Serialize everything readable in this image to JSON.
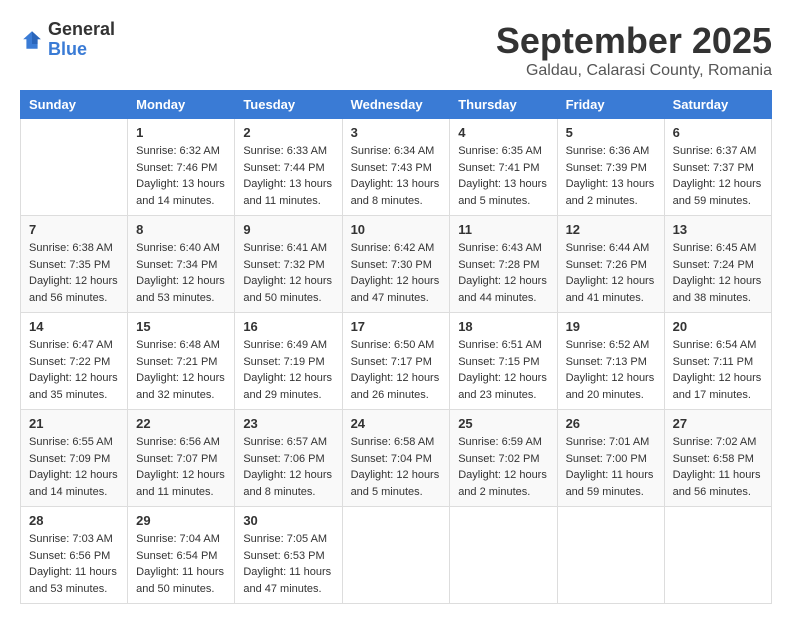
{
  "header": {
    "logo_general": "General",
    "logo_blue": "Blue",
    "month_title": "September 2025",
    "location": "Galdau, Calarasi County, Romania"
  },
  "weekdays": [
    "Sunday",
    "Monday",
    "Tuesday",
    "Wednesday",
    "Thursday",
    "Friday",
    "Saturday"
  ],
  "weeks": [
    [
      {
        "day": "",
        "info": ""
      },
      {
        "day": "1",
        "info": "Sunrise: 6:32 AM\nSunset: 7:46 PM\nDaylight: 13 hours\nand 14 minutes."
      },
      {
        "day": "2",
        "info": "Sunrise: 6:33 AM\nSunset: 7:44 PM\nDaylight: 13 hours\nand 11 minutes."
      },
      {
        "day": "3",
        "info": "Sunrise: 6:34 AM\nSunset: 7:43 PM\nDaylight: 13 hours\nand 8 minutes."
      },
      {
        "day": "4",
        "info": "Sunrise: 6:35 AM\nSunset: 7:41 PM\nDaylight: 13 hours\nand 5 minutes."
      },
      {
        "day": "5",
        "info": "Sunrise: 6:36 AM\nSunset: 7:39 PM\nDaylight: 13 hours\nand 2 minutes."
      },
      {
        "day": "6",
        "info": "Sunrise: 6:37 AM\nSunset: 7:37 PM\nDaylight: 12 hours\nand 59 minutes."
      }
    ],
    [
      {
        "day": "7",
        "info": "Sunrise: 6:38 AM\nSunset: 7:35 PM\nDaylight: 12 hours\nand 56 minutes."
      },
      {
        "day": "8",
        "info": "Sunrise: 6:40 AM\nSunset: 7:34 PM\nDaylight: 12 hours\nand 53 minutes."
      },
      {
        "day": "9",
        "info": "Sunrise: 6:41 AM\nSunset: 7:32 PM\nDaylight: 12 hours\nand 50 minutes."
      },
      {
        "day": "10",
        "info": "Sunrise: 6:42 AM\nSunset: 7:30 PM\nDaylight: 12 hours\nand 47 minutes."
      },
      {
        "day": "11",
        "info": "Sunrise: 6:43 AM\nSunset: 7:28 PM\nDaylight: 12 hours\nand 44 minutes."
      },
      {
        "day": "12",
        "info": "Sunrise: 6:44 AM\nSunset: 7:26 PM\nDaylight: 12 hours\nand 41 minutes."
      },
      {
        "day": "13",
        "info": "Sunrise: 6:45 AM\nSunset: 7:24 PM\nDaylight: 12 hours\nand 38 minutes."
      }
    ],
    [
      {
        "day": "14",
        "info": "Sunrise: 6:47 AM\nSunset: 7:22 PM\nDaylight: 12 hours\nand 35 minutes."
      },
      {
        "day": "15",
        "info": "Sunrise: 6:48 AM\nSunset: 7:21 PM\nDaylight: 12 hours\nand 32 minutes."
      },
      {
        "day": "16",
        "info": "Sunrise: 6:49 AM\nSunset: 7:19 PM\nDaylight: 12 hours\nand 29 minutes."
      },
      {
        "day": "17",
        "info": "Sunrise: 6:50 AM\nSunset: 7:17 PM\nDaylight: 12 hours\nand 26 minutes."
      },
      {
        "day": "18",
        "info": "Sunrise: 6:51 AM\nSunset: 7:15 PM\nDaylight: 12 hours\nand 23 minutes."
      },
      {
        "day": "19",
        "info": "Sunrise: 6:52 AM\nSunset: 7:13 PM\nDaylight: 12 hours\nand 20 minutes."
      },
      {
        "day": "20",
        "info": "Sunrise: 6:54 AM\nSunset: 7:11 PM\nDaylight: 12 hours\nand 17 minutes."
      }
    ],
    [
      {
        "day": "21",
        "info": "Sunrise: 6:55 AM\nSunset: 7:09 PM\nDaylight: 12 hours\nand 14 minutes."
      },
      {
        "day": "22",
        "info": "Sunrise: 6:56 AM\nSunset: 7:07 PM\nDaylight: 12 hours\nand 11 minutes."
      },
      {
        "day": "23",
        "info": "Sunrise: 6:57 AM\nSunset: 7:06 PM\nDaylight: 12 hours\nand 8 minutes."
      },
      {
        "day": "24",
        "info": "Sunrise: 6:58 AM\nSunset: 7:04 PM\nDaylight: 12 hours\nand 5 minutes."
      },
      {
        "day": "25",
        "info": "Sunrise: 6:59 AM\nSunset: 7:02 PM\nDaylight: 12 hours\nand 2 minutes."
      },
      {
        "day": "26",
        "info": "Sunrise: 7:01 AM\nSunset: 7:00 PM\nDaylight: 11 hours\nand 59 minutes."
      },
      {
        "day": "27",
        "info": "Sunrise: 7:02 AM\nSunset: 6:58 PM\nDaylight: 11 hours\nand 56 minutes."
      }
    ],
    [
      {
        "day": "28",
        "info": "Sunrise: 7:03 AM\nSunset: 6:56 PM\nDaylight: 11 hours\nand 53 minutes."
      },
      {
        "day": "29",
        "info": "Sunrise: 7:04 AM\nSunset: 6:54 PM\nDaylight: 11 hours\nand 50 minutes."
      },
      {
        "day": "30",
        "info": "Sunrise: 7:05 AM\nSunset: 6:53 PM\nDaylight: 11 hours\nand 47 minutes."
      },
      {
        "day": "",
        "info": ""
      },
      {
        "day": "",
        "info": ""
      },
      {
        "day": "",
        "info": ""
      },
      {
        "day": "",
        "info": ""
      }
    ]
  ]
}
